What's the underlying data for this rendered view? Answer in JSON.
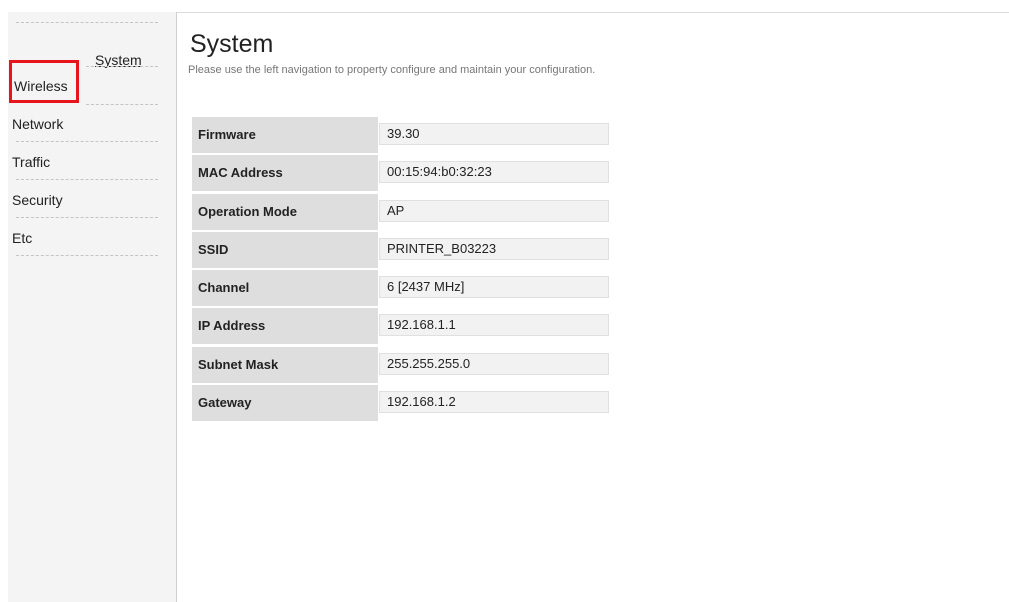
{
  "sidebar": {
    "system_label": "System",
    "items": [
      {
        "label": "Wireless"
      },
      {
        "label": "Network"
      },
      {
        "label": "Traffic"
      },
      {
        "label": "Security"
      },
      {
        "label": "Etc"
      }
    ]
  },
  "header": {
    "title": "System",
    "description": "Please use the left navigation to property configure and maintain your configuration."
  },
  "info_rows": [
    {
      "label": "Firmware",
      "value": "39.30"
    },
    {
      "label": "MAC Address",
      "value": "00:15:94:b0:32:23"
    },
    {
      "label": "Operation Mode",
      "value": "AP"
    },
    {
      "label": "SSID",
      "value": "PRINTER_B03223"
    },
    {
      "label": "Channel",
      "value": "6 [2437 MHz]"
    },
    {
      "label": "IP Address",
      "value": "192.168.1.1"
    },
    {
      "label": "Subnet Mask",
      "value": "255.255.255.0"
    },
    {
      "label": "Gateway",
      "value": "192.168.1.2"
    }
  ],
  "colors": {
    "highlight": "#e8141b",
    "sidebar_bg": "#f4f4f4",
    "label_bg": "#dedede",
    "value_bg": "#f2f2f2"
  }
}
